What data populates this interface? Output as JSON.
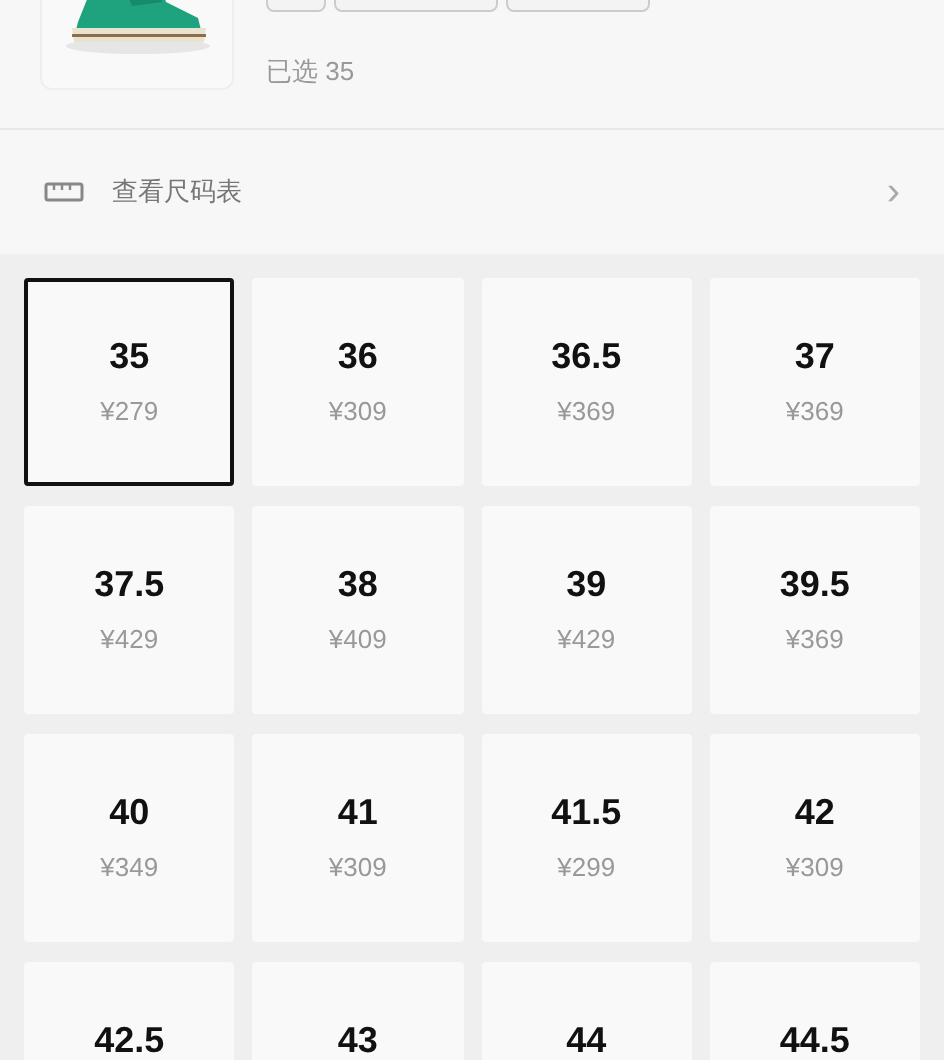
{
  "product": {
    "selected_label": "已选 35"
  },
  "size_chart_link": {
    "label": "查看尺码表",
    "chevron": "›"
  },
  "sizes": [
    {
      "size": "35",
      "price": "¥279",
      "selected": true
    },
    {
      "size": "36",
      "price": "¥309",
      "selected": false
    },
    {
      "size": "36.5",
      "price": "¥369",
      "selected": false
    },
    {
      "size": "37",
      "price": "¥369",
      "selected": false
    },
    {
      "size": "37.5",
      "price": "¥429",
      "selected": false
    },
    {
      "size": "38",
      "price": "¥409",
      "selected": false
    },
    {
      "size": "39",
      "price": "¥429",
      "selected": false
    },
    {
      "size": "39.5",
      "price": "¥369",
      "selected": false
    },
    {
      "size": "40",
      "price": "¥349",
      "selected": false
    },
    {
      "size": "41",
      "price": "¥309",
      "selected": false
    },
    {
      "size": "41.5",
      "price": "¥299",
      "selected": false
    },
    {
      "size": "42",
      "price": "¥309",
      "selected": false
    },
    {
      "size": "42.5",
      "selected": false
    },
    {
      "size": "43",
      "selected": false
    },
    {
      "size": "44",
      "selected": false
    },
    {
      "size": "44.5",
      "selected": false
    }
  ]
}
